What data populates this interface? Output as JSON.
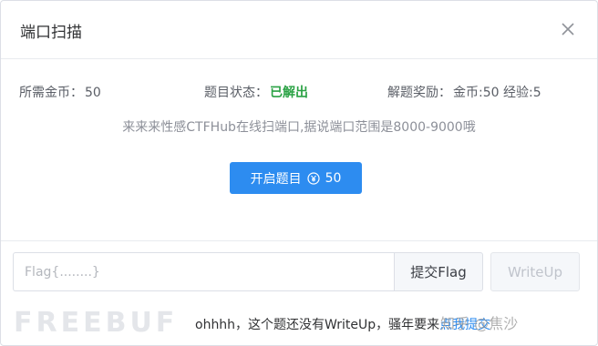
{
  "dialog": {
    "title": "端口扫描"
  },
  "info": {
    "cost_label": "所需金币：",
    "cost_value": "50",
    "status_label": "题目状态：",
    "status_value": "已解出",
    "reward_label": "解题奖励：",
    "reward_value": "金币:50 经验:5"
  },
  "description": "来来来性感CTFHub在线扫端口,据说端口范围是8000-9000哦",
  "start_button": {
    "label": "开启题目",
    "cost": "50"
  },
  "flag_input": {
    "placeholder": "Flag{........}",
    "value": ""
  },
  "submit_label": "提交Flag",
  "writeup_label": "WriteUp",
  "note": {
    "text": "ohhhh，这个题还没有WriteUp，骚年要来",
    "link": "点我提交"
  },
  "watermarks": {
    "freebuf": "FREEBUF",
    "zhihu": "知乎 @焦沙"
  },
  "colors": {
    "accent": "#2d8cf0",
    "solved": "#2ba245",
    "disabled_text": "#c0c4cc"
  },
  "icons": [
    "close-icon",
    "coin-icon"
  ]
}
